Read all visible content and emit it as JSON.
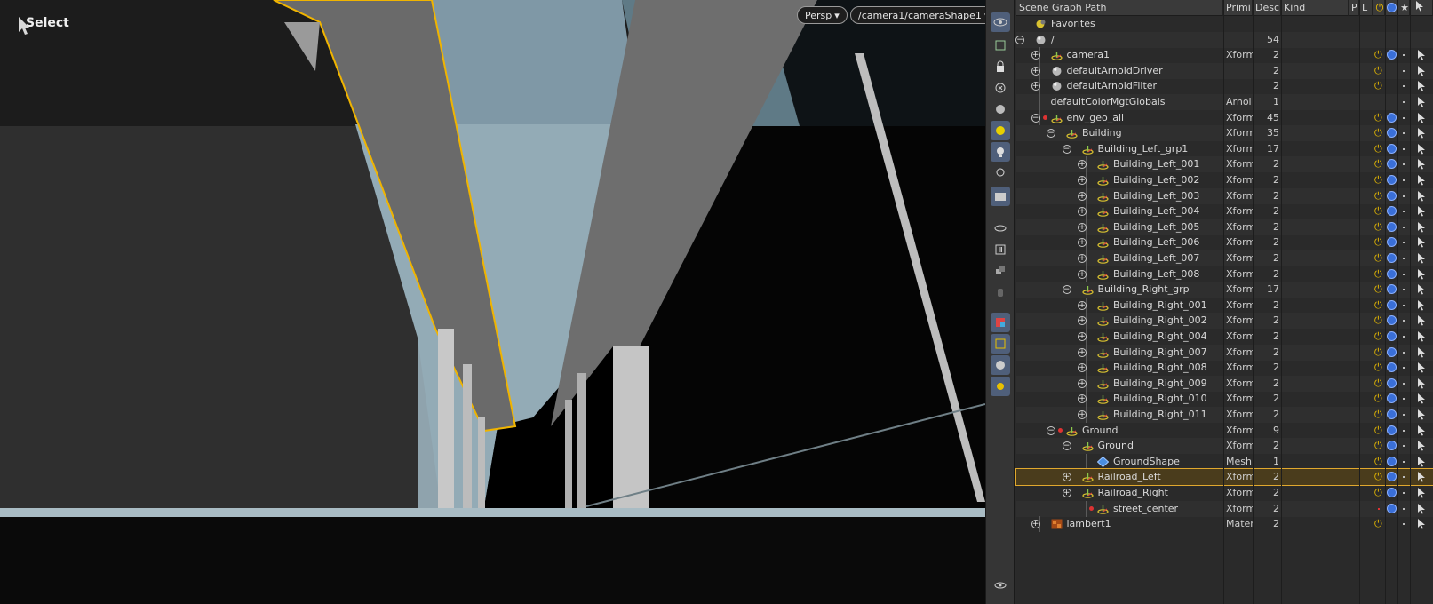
{
  "viewport": {
    "tool_label": "Select",
    "view_menu": "Persp",
    "camera_menu": "/camera1/cameraShape1"
  },
  "tree": {
    "columns": {
      "path": "Scene Graph Path",
      "prim": "Primi",
      "desc": "Desc",
      "kind": "Kind",
      "p": "P",
      "l": "L"
    },
    "rows": [
      {
        "name": "Favorites",
        "depth": 0,
        "exp": "",
        "icon": "favorites",
        "type": "",
        "desc": "",
        "power": false,
        "eye": false
      },
      {
        "name": "/",
        "depth": 0,
        "exp": "-",
        "icon": "sphere",
        "type": "",
        "desc": "54",
        "power": false,
        "eye": false
      },
      {
        "name": "camera1",
        "depth": 1,
        "exp": "+",
        "icon": "xform",
        "type": "Xform",
        "desc": "2",
        "power": true,
        "eye": true
      },
      {
        "name": "defaultArnoldDriver",
        "depth": 1,
        "exp": "+",
        "icon": "sphere",
        "type": "",
        "desc": "2",
        "power": true,
        "eye": false
      },
      {
        "name": "defaultArnoldFilter",
        "depth": 1,
        "exp": "+",
        "icon": "sphere",
        "type": "",
        "desc": "2",
        "power": true,
        "eye": false
      },
      {
        "name": "defaultColorMgtGlobals",
        "depth": 1,
        "exp": "",
        "icon": "",
        "type": "Arnol",
        "desc": "1",
        "power": false,
        "eye": false
      },
      {
        "name": "env_geo_all",
        "depth": 1,
        "exp": "-",
        "icon": "xform",
        "dot": true,
        "type": "Xform",
        "desc": "45",
        "power": true,
        "eye": true
      },
      {
        "name": "Building",
        "depth": 2,
        "exp": "-",
        "icon": "xform",
        "type": "Xform",
        "desc": "35",
        "power": true,
        "eye": true
      },
      {
        "name": "Building_Left_grp1",
        "depth": 3,
        "exp": "-",
        "icon": "xform",
        "type": "Xform",
        "desc": "17",
        "power": true,
        "eye": true
      },
      {
        "name": "Building_Left_001",
        "depth": 4,
        "exp": "+",
        "icon": "xform",
        "type": "Xform",
        "desc": "2",
        "power": true,
        "eye": true
      },
      {
        "name": "Building_Left_002",
        "depth": 4,
        "exp": "+",
        "icon": "xform",
        "type": "Xform",
        "desc": "2",
        "power": true,
        "eye": true
      },
      {
        "name": "Building_Left_003",
        "depth": 4,
        "exp": "+",
        "icon": "xform",
        "type": "Xform",
        "desc": "2",
        "power": true,
        "eye": true
      },
      {
        "name": "Building_Left_004",
        "depth": 4,
        "exp": "+",
        "icon": "xform",
        "type": "Xform",
        "desc": "2",
        "power": true,
        "eye": true
      },
      {
        "name": "Building_Left_005",
        "depth": 4,
        "exp": "+",
        "icon": "xform",
        "type": "Xform",
        "desc": "2",
        "power": true,
        "eye": true
      },
      {
        "name": "Building_Left_006",
        "depth": 4,
        "exp": "+",
        "icon": "xform",
        "type": "Xform",
        "desc": "2",
        "power": true,
        "eye": true
      },
      {
        "name": "Building_Left_007",
        "depth": 4,
        "exp": "+",
        "icon": "xform",
        "type": "Xform",
        "desc": "2",
        "power": true,
        "eye": true
      },
      {
        "name": "Building_Left_008",
        "depth": 4,
        "exp": "+",
        "icon": "xform",
        "type": "Xform",
        "desc": "2",
        "power": true,
        "eye": true
      },
      {
        "name": "Building_Right_grp",
        "depth": 3,
        "exp": "-",
        "icon": "xform",
        "type": "Xform",
        "desc": "17",
        "power": true,
        "eye": true
      },
      {
        "name": "Building_Right_001",
        "depth": 4,
        "exp": "+",
        "icon": "xform",
        "type": "Xform",
        "desc": "2",
        "power": true,
        "eye": true
      },
      {
        "name": "Building_Right_002",
        "depth": 4,
        "exp": "+",
        "icon": "xform",
        "type": "Xform",
        "desc": "2",
        "power": true,
        "eye": true
      },
      {
        "name": "Building_Right_004",
        "depth": 4,
        "exp": "+",
        "icon": "xform",
        "type": "Xform",
        "desc": "2",
        "power": true,
        "eye": true
      },
      {
        "name": "Building_Right_007",
        "depth": 4,
        "exp": "+",
        "icon": "xform",
        "type": "Xform",
        "desc": "2",
        "power": true,
        "eye": true
      },
      {
        "name": "Building_Right_008",
        "depth": 4,
        "exp": "+",
        "icon": "xform",
        "type": "Xform",
        "desc": "2",
        "power": true,
        "eye": true
      },
      {
        "name": "Building_Right_009",
        "depth": 4,
        "exp": "+",
        "icon": "xform",
        "type": "Xform",
        "desc": "2",
        "power": true,
        "eye": true
      },
      {
        "name": "Building_Right_010",
        "depth": 4,
        "exp": "+",
        "icon": "xform",
        "type": "Xform",
        "desc": "2",
        "power": true,
        "eye": true
      },
      {
        "name": "Building_Right_011",
        "depth": 4,
        "exp": "+",
        "icon": "xform",
        "type": "Xform",
        "desc": "2",
        "power": true,
        "eye": true
      },
      {
        "name": "Ground",
        "depth": 2,
        "exp": "-",
        "icon": "xform",
        "dot": true,
        "type": "Xform",
        "desc": "9",
        "power": true,
        "eye": true
      },
      {
        "name": "Ground",
        "depth": 3,
        "exp": "-",
        "icon": "xform",
        "type": "Xform",
        "desc": "2",
        "power": true,
        "eye": true
      },
      {
        "name": "GroundShape",
        "depth": 4,
        "exp": "",
        "icon": "mesh",
        "type": "Mesh",
        "desc": "1",
        "power": true,
        "eye": true
      },
      {
        "name": "Railroad_Left",
        "depth": 3,
        "exp": "+",
        "icon": "xform",
        "type": "Xform",
        "desc": "2",
        "power": true,
        "eye": true,
        "selected": true
      },
      {
        "name": "Railroad_Right",
        "depth": 3,
        "exp": "+",
        "icon": "xform",
        "type": "Xform",
        "desc": "2",
        "power": true,
        "eye": true
      },
      {
        "name": "street_center",
        "depth": 4,
        "exp": "",
        "icon": "xform",
        "dot": true,
        "type": "Xform",
        "desc": "2",
        "power": false,
        "eye": true
      },
      {
        "name": "lambert1",
        "depth": 1,
        "exp": "+",
        "icon": "material",
        "type": "Materi",
        "desc": "2",
        "power": true,
        "eye": false
      }
    ]
  },
  "colors": {
    "selection": "#e0a82e",
    "power": "#f0c000",
    "eye": "#3a6fd8"
  }
}
